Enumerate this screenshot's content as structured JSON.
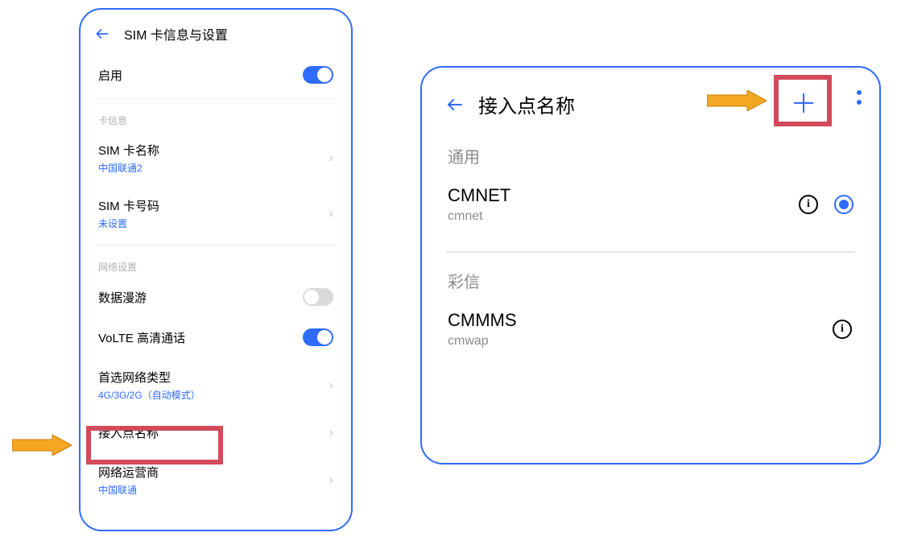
{
  "left": {
    "header": {
      "title": "SIM 卡信息与设置"
    },
    "enable": {
      "label": "启用",
      "on": true
    },
    "section_card": {
      "title": "卡信息"
    },
    "sim_name": {
      "label": "SIM 卡名称",
      "value": "中国联通2"
    },
    "sim_number": {
      "label": "SIM 卡号码",
      "value": "未设置"
    },
    "section_net": {
      "title": "网络设置"
    },
    "data_roaming": {
      "label": "数据漫游",
      "on": false
    },
    "volte": {
      "label": "VoLTE 高清通话",
      "on": true
    },
    "pref_net": {
      "label": "首选网络类型",
      "value": "4G/3G/2G（自动模式）"
    },
    "apn": {
      "label": "接入点名称"
    },
    "carrier": {
      "label": "网络运营商",
      "value": "中国联通"
    }
  },
  "right": {
    "header": {
      "title": "接入点名称"
    },
    "section_general": {
      "title": "通用"
    },
    "apn1": {
      "name": "CMNET",
      "sub": "cmnet",
      "selected": true
    },
    "section_mms": {
      "title": "彩信"
    },
    "apn2": {
      "name": "CMMMS",
      "sub": "cmwap"
    }
  }
}
